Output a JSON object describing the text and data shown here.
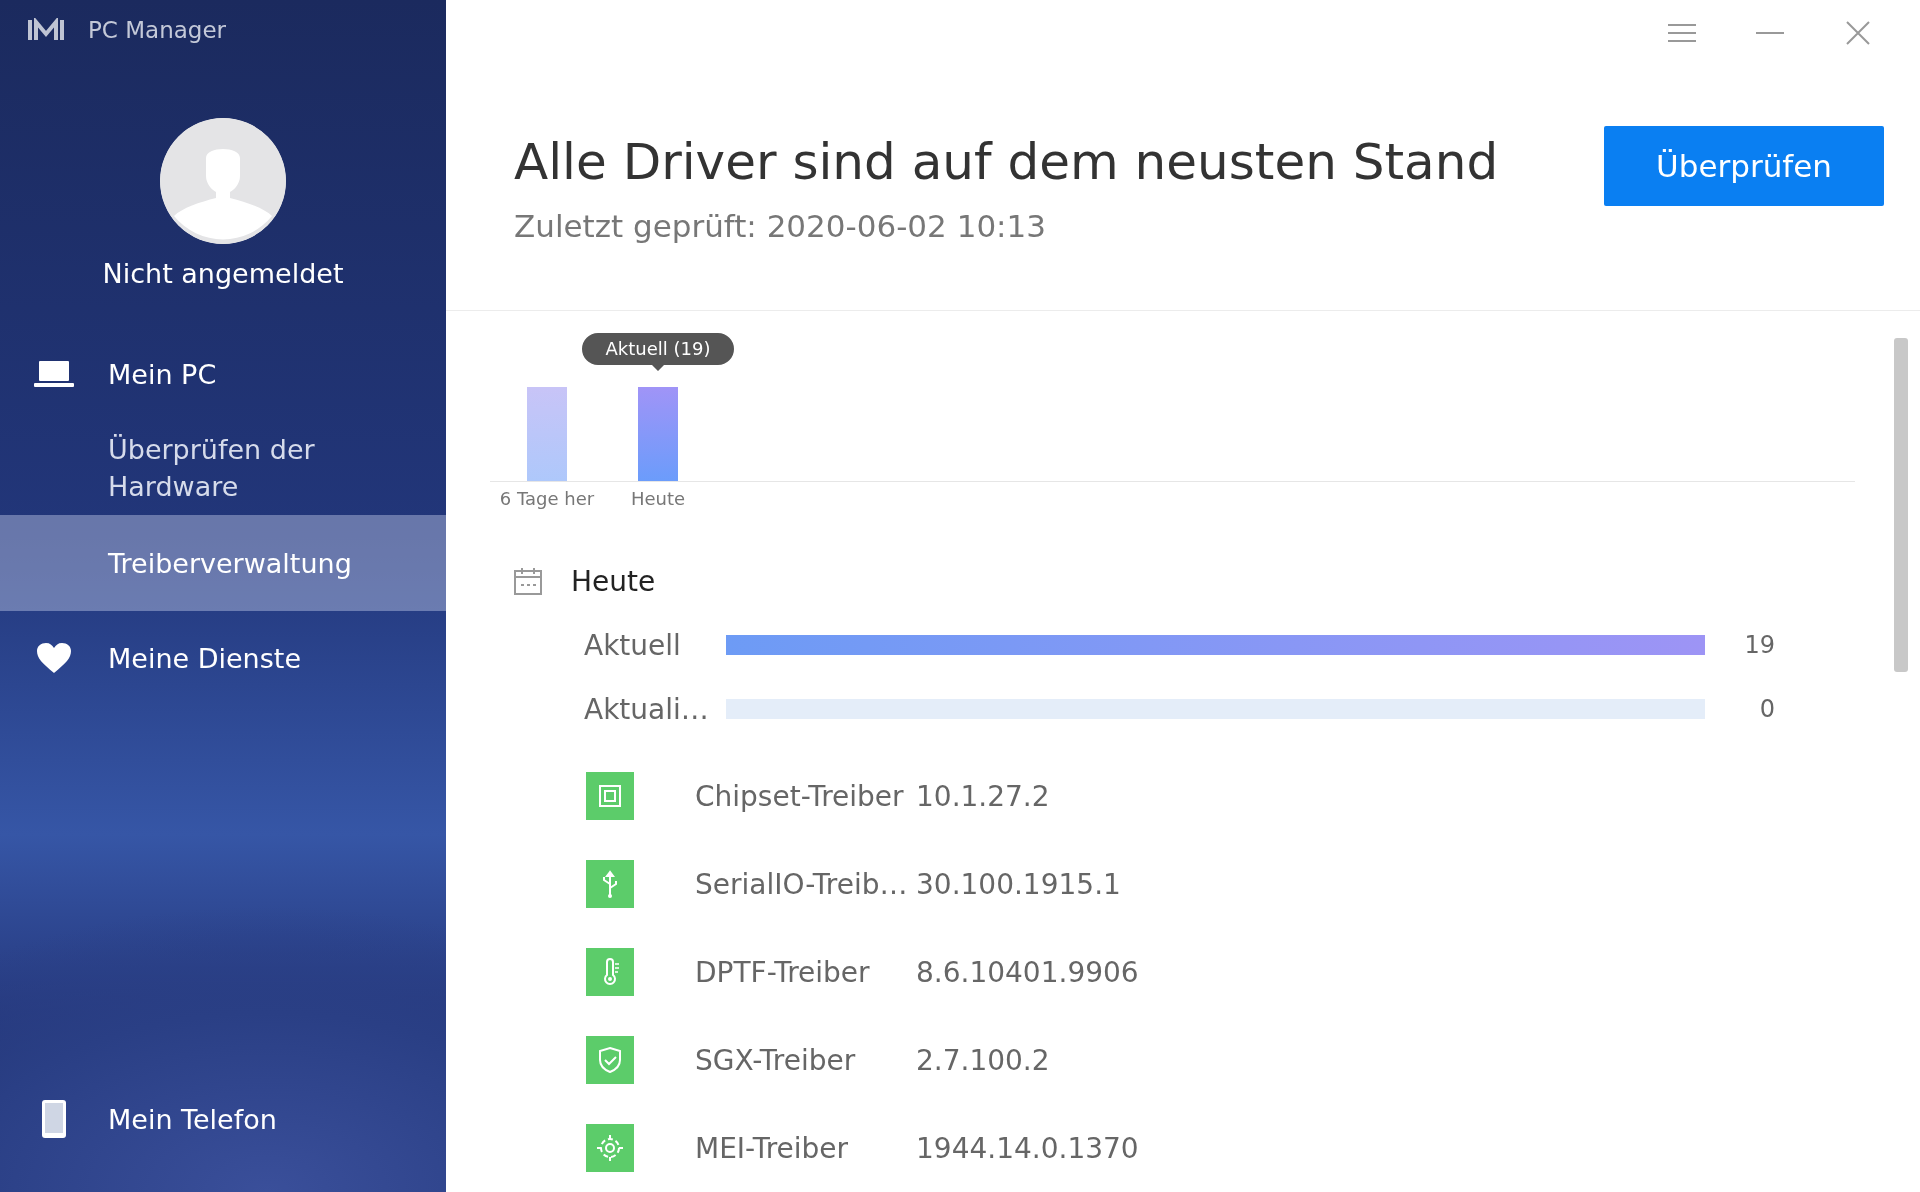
{
  "app": {
    "title": "PC Manager"
  },
  "account": {
    "name": "Nicht angemeldet"
  },
  "nav": [
    {
      "label": "Mein PC",
      "selected": false,
      "children": [
        {
          "label": "Überprüfen der Hardware",
          "selected": false
        },
        {
          "label": "Treiberverwaltung",
          "selected": true
        }
      ]
    },
    {
      "label": "Meine Dienste",
      "selected": false
    }
  ],
  "footer_nav": {
    "label": "Mein Telefon",
    "selected": false
  },
  "header": {
    "title": "Alle Driver sind auf dem neusten Stand",
    "subtitle": "Zuletzt geprüft: 2020-06-02 10:13",
    "button": "Überprüfen"
  },
  "history_chart": {
    "labels": [
      "6 Tage her",
      "Heute"
    ],
    "tooltip": "Aktuell (19)"
  },
  "summary": {
    "title": "Heute",
    "rows": [
      {
        "label": "Aktuell",
        "level": 1,
        "count": "19"
      },
      {
        "label": "Aktuali…",
        "level": 0,
        "count": "0"
      }
    ]
  },
  "drivers": [
    {
      "name": "Chipset-Treiber",
      "version": "10.1.27.2"
    },
    {
      "name": "SerialIO-Treib…",
      "version": "30.100.1915.1"
    },
    {
      "name": "DPTF-Treiber",
      "version": "8.6.10401.9906"
    },
    {
      "name": "SGX-Treiber",
      "version": "2.7.100.2"
    },
    {
      "name": "MEI-Treiber",
      "version": "1944.14.0.1370"
    }
  ]
}
